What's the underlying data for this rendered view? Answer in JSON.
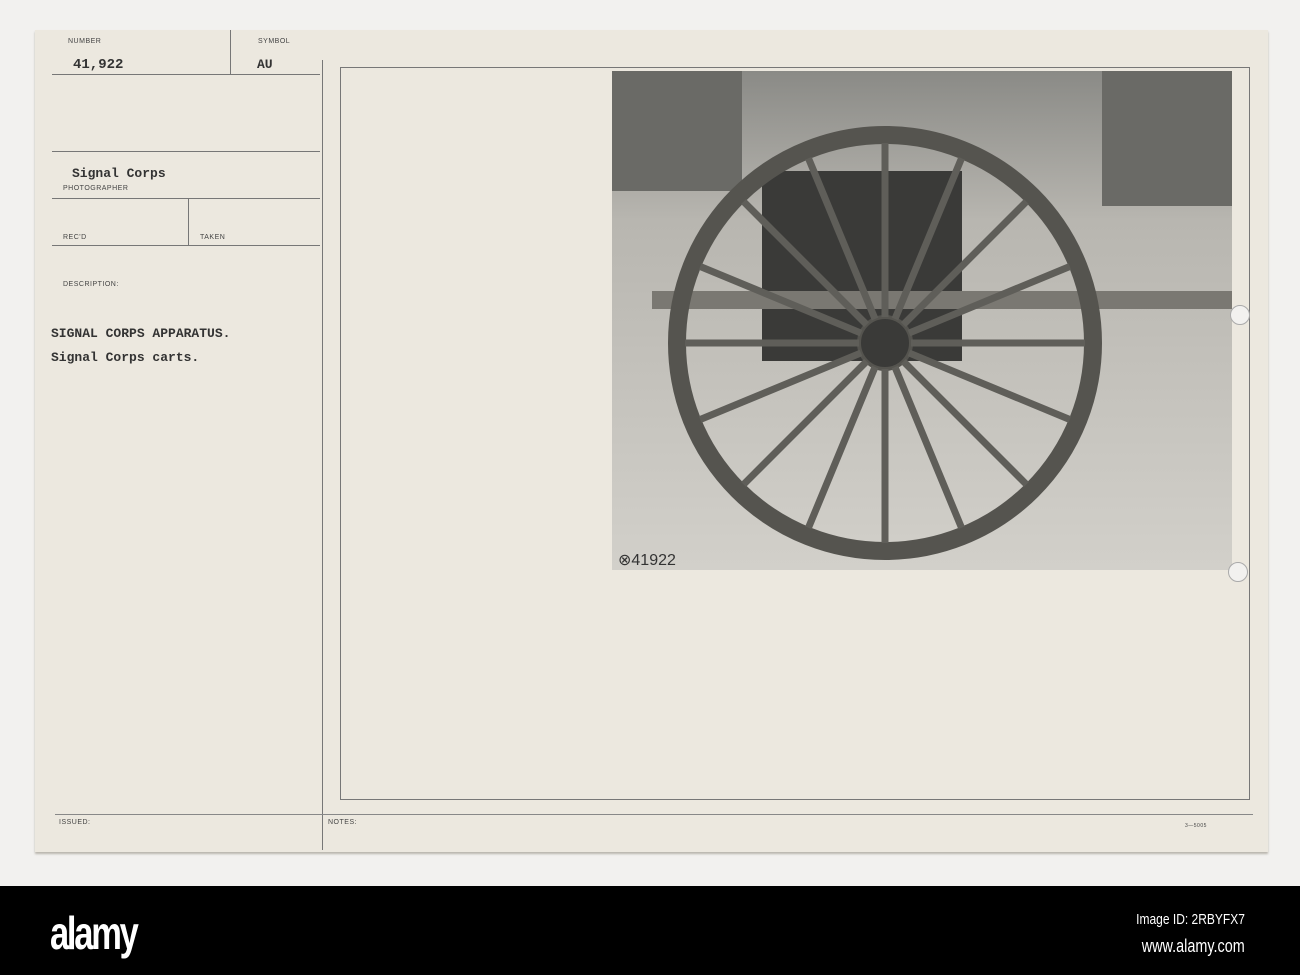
{
  "card": {
    "number_label": "NUMBER",
    "number": "41,922",
    "symbol_label": "SYMBOL",
    "symbol": "AU",
    "photographer": "Signal Corps",
    "photographer_label": "PHOTOGRAPHER",
    "recd_label": "REC'D",
    "taken_label": "TAKEN",
    "description_label": "DESCRIPTION:",
    "description_line1": "SIGNAL CORPS APPARATUS.",
    "description_line2": "Signal Corps carts.",
    "issued_label": "ISSUED:",
    "notes_label": "NOTES:",
    "form_code": "3—5005"
  },
  "photo": {
    "handwritten_number": "⊗41922"
  },
  "footer": {
    "logo": "alamy",
    "image_id": "Image ID: 2RBYFX7",
    "url": "www.alamy.com"
  }
}
